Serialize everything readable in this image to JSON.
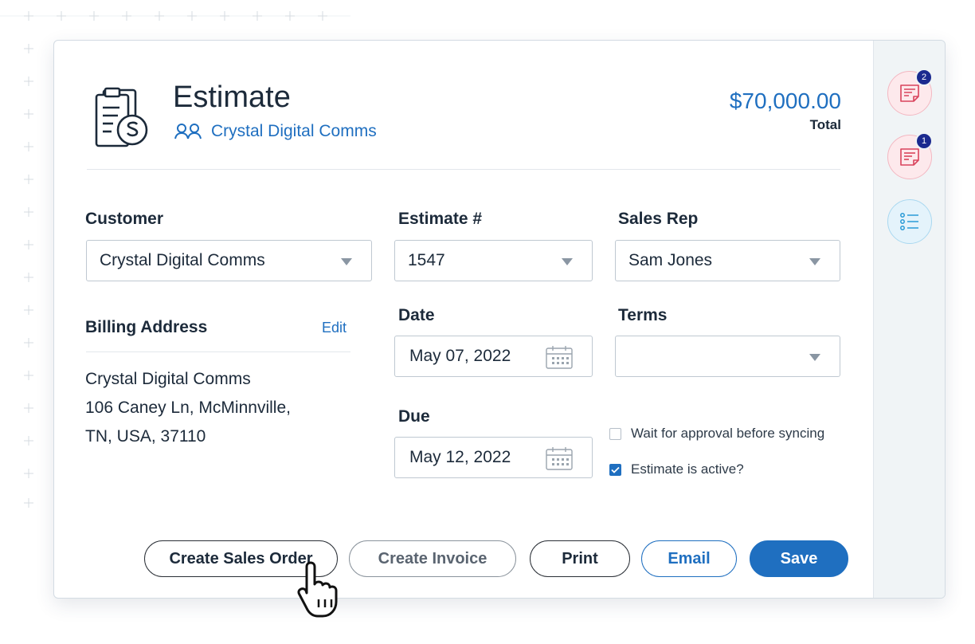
{
  "header": {
    "title": "Estimate",
    "customer_link": "Crystal Digital Comms",
    "total_amount": "$70,000.00",
    "total_label": "Total"
  },
  "form": {
    "customer": {
      "label": "Customer",
      "value": "Crystal Digital Comms"
    },
    "estimate_no": {
      "label": "Estimate #",
      "value": "1547"
    },
    "sales_rep": {
      "label": "Sales Rep",
      "value": "Sam Jones"
    },
    "date": {
      "label": "Date",
      "value": "May 07, 2022"
    },
    "terms": {
      "label": "Terms",
      "value": ""
    },
    "due": {
      "label": "Due",
      "value": "May 12, 2022"
    },
    "billing": {
      "label": "Billing Address",
      "edit_label": "Edit",
      "lines": [
        "Crystal Digital Comms",
        "106 Caney Ln, McMinnville,",
        "TN, USA, 37110"
      ]
    },
    "checkboxes": [
      {
        "label": "Wait for approval before syncing",
        "checked": false
      },
      {
        "label": "Estimate is active?",
        "checked": true
      }
    ]
  },
  "actions": {
    "create_sales_order": "Create Sales Order",
    "create_invoice": "Create Invoice",
    "print": "Print",
    "email": "Email",
    "save": "Save"
  },
  "sidebar": {
    "items": [
      {
        "icon": "notes-icon",
        "badge": "2"
      },
      {
        "icon": "notes-icon",
        "badge": "1"
      },
      {
        "icon": "checklist-icon"
      }
    ]
  },
  "colors": {
    "accent": "#1f6fc0",
    "badge": "#1b2a8f",
    "text": "#1c2a3a"
  }
}
